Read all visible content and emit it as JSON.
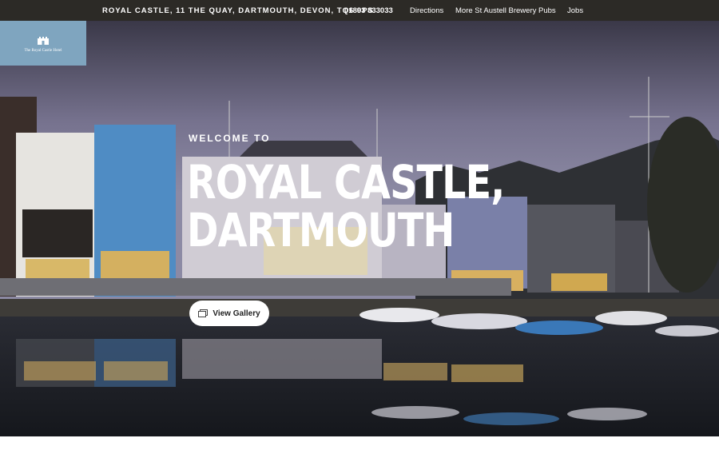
{
  "topbar": {
    "address": "ROYAL CASTLE, 11 THE QUAY, DARTMOUTH, DEVON, TQ6 9PS",
    "phone": "01803 833033",
    "links": [
      "Directions",
      "More St Austell Brewery Pubs",
      "Jobs"
    ]
  },
  "logo": {
    "icon": "castle-icon",
    "text": "The Royal Castle Hotel"
  },
  "hero": {
    "kicker": "WELCOME TO",
    "title_line1": "ROYAL CASTLE,",
    "title_line2": "DARTMOUTH",
    "gallery_button": "View Gallery",
    "gallery_icon": "gallery-icon"
  },
  "colors": {
    "topbar_bg": "#2c2a26",
    "logo_bg": "#7fa5bf",
    "text": "#ffffff"
  }
}
